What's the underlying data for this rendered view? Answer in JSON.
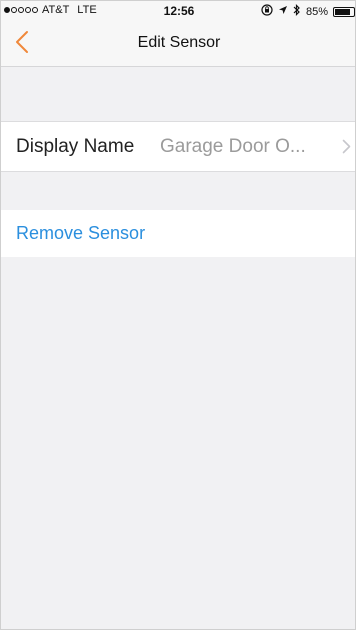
{
  "status_bar": {
    "carrier": "AT&T",
    "network": "LTE",
    "time": "12:56",
    "battery": "85%",
    "battery_level": 0.85,
    "signal_filled": 1,
    "signal_total": 5
  },
  "nav": {
    "title": "Edit Sensor",
    "back_icon": "chevron-left-icon"
  },
  "rows": {
    "display_name": {
      "label": "Display Name",
      "value": "Garage Door O...",
      "icon": "chevron-right-icon"
    },
    "remove": {
      "label": "Remove Sensor"
    }
  },
  "colors": {
    "accent_orange": "#f0883a",
    "link_blue": "#2b8fde",
    "background": "#f1f1f3"
  }
}
